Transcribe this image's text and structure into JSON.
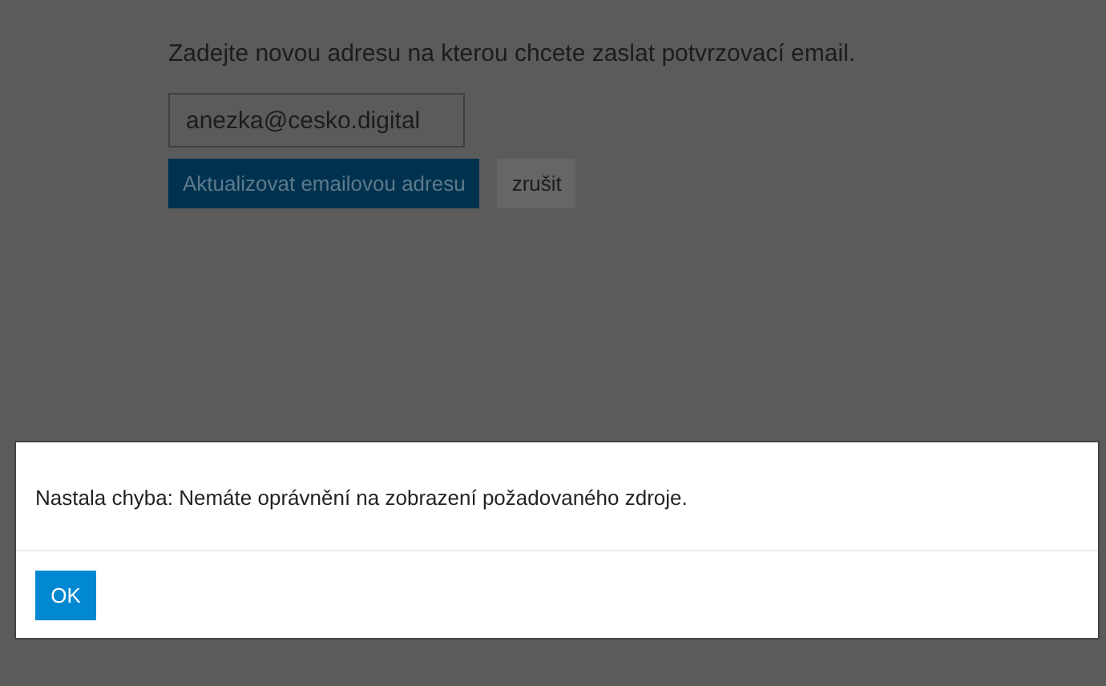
{
  "form": {
    "instruction": "Zadejte novou adresu na kterou chcete zaslat potvrzovací email.",
    "email_value": "anezka@cesko.digital",
    "buttons": [
      {
        "label": "Aktualizovat emailovou adresu",
        "kind": "primary"
      },
      {
        "label": "zrušit",
        "kind": "secondary"
      }
    ]
  },
  "dialog": {
    "message": "Nastala chyba: Nemáte oprávnění na zobrazení požadovaného zdroje.",
    "button": "OK"
  }
}
